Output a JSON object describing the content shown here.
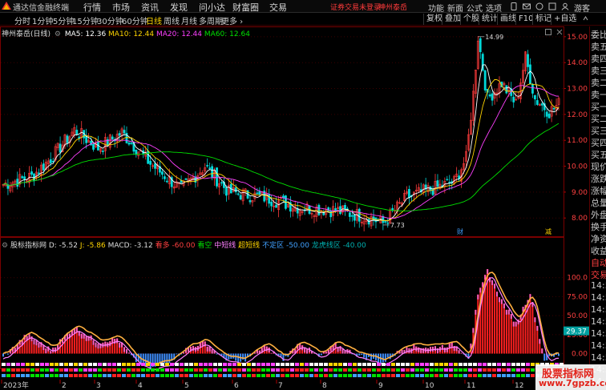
{
  "titlebar": {
    "app_name": "通达信金融终端",
    "menus": [
      "行情",
      "市场",
      "资讯",
      "发现",
      "问小达",
      "财富圈",
      "交易"
    ],
    "login_status": "证券交易未登录",
    "stock_name": "神州泰岳",
    "right_menus": [
      "功能",
      "新面",
      "公式",
      "选项"
    ],
    "guest": "游客"
  },
  "periods": {
    "tabs": [
      "分时",
      "1分钟",
      "5分钟",
      "15分钟",
      "30分钟",
      "60分钟",
      "日线",
      "周线",
      "月线",
      "多周期",
      "更多 ›"
    ],
    "active": "日线"
  },
  "toolbar": {
    "buttons": [
      "复权",
      "叠加",
      "个股",
      "统计",
      "画线",
      "F10",
      "标记",
      "+自选"
    ]
  },
  "main_chart": {
    "stock_label": "神州泰岳(日线)",
    "ma5_label": "MA5: 12.36",
    "ma10_label": "MA10: 12.44",
    "ma20_label": "MA20: 12.44",
    "ma60_label": "MA60: 12.64",
    "y_ticks": [
      "15.00",
      "14.00",
      "13.00",
      "12.00",
      "11.00",
      "10.00",
      "9.00",
      "8.00"
    ],
    "high_label": "14.99",
    "low_label": "7.73",
    "marker_cai": "财",
    "marker_jian": "减",
    "colors": {
      "ma5": "#ffffff",
      "ma10": "#ffd400",
      "ma20": "#ff40ff",
      "ma60": "#00e000",
      "up": "#ff3c3c",
      "down": "#00d8d8"
    }
  },
  "indicator": {
    "name": "股标指标网",
    "d": "D: -5.52",
    "j": "J: -5.86",
    "macd": "MACD: -3.12",
    "duo": "看多",
    "duo_val": "-60.00",
    "kong": "看空",
    "mid": "中短线",
    "super": "超短线",
    "neutral": "不定区",
    "neutral_val": "-50.00",
    "dragon": "龙虎线区",
    "dragon_val": "-40.00",
    "y_ticks": [
      "100.0",
      "75.00",
      "50.00",
      "25.00",
      "0.00"
    ],
    "cursor_value": "29.37"
  },
  "xaxis": {
    "labels": [
      "2023年",
      "2",
      "3",
      "4",
      "5",
      "6",
      "7",
      "8",
      "9",
      "10",
      "11",
      "12"
    ]
  },
  "right_panel": {
    "items": [
      "委比",
      "卖五",
      "卖四",
      "卖三",
      "卖二",
      "卖一",
      "买一",
      "买二",
      "买三",
      "买四",
      "买五",
      "现价",
      "涨跌",
      "涨幅",
      "总量",
      "外盘",
      "换手",
      "净资",
      "收益",
      "自动",
      "交易",
      "14:5",
      "14:5",
      "14:5",
      "14:5",
      "14:5",
      "14:5",
      "14:5",
      "14:5",
      "14:5"
    ]
  },
  "watermark": {
    "line1": "股票指标网",
    "line2": "www.7gpzb.com"
  }
}
